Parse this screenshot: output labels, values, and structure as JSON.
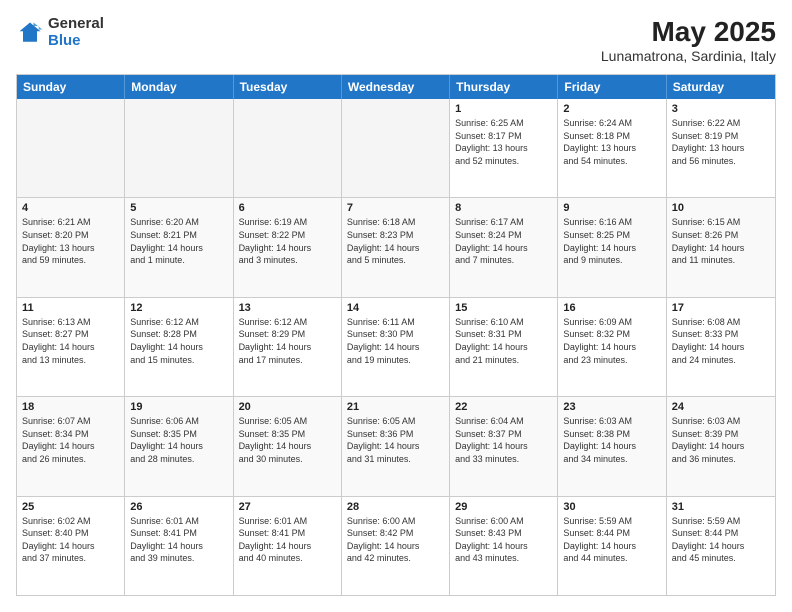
{
  "logo": {
    "general": "General",
    "blue": "Blue"
  },
  "header": {
    "month_year": "May 2025",
    "location": "Lunamatrona, Sardinia, Italy"
  },
  "days_of_week": [
    "Sunday",
    "Monday",
    "Tuesday",
    "Wednesday",
    "Thursday",
    "Friday",
    "Saturday"
  ],
  "weeks": [
    [
      {
        "day": "",
        "data": "",
        "empty": true
      },
      {
        "day": "",
        "data": "",
        "empty": true
      },
      {
        "day": "",
        "data": "",
        "empty": true
      },
      {
        "day": "",
        "data": "",
        "empty": true
      },
      {
        "day": "1",
        "data": "Sunrise: 6:25 AM\nSunset: 8:17 PM\nDaylight: 13 hours\nand 52 minutes.",
        "empty": false
      },
      {
        "day": "2",
        "data": "Sunrise: 6:24 AM\nSunset: 8:18 PM\nDaylight: 13 hours\nand 54 minutes.",
        "empty": false
      },
      {
        "day": "3",
        "data": "Sunrise: 6:22 AM\nSunset: 8:19 PM\nDaylight: 13 hours\nand 56 minutes.",
        "empty": false
      }
    ],
    [
      {
        "day": "4",
        "data": "Sunrise: 6:21 AM\nSunset: 8:20 PM\nDaylight: 13 hours\nand 59 minutes.",
        "empty": false
      },
      {
        "day": "5",
        "data": "Sunrise: 6:20 AM\nSunset: 8:21 PM\nDaylight: 14 hours\nand 1 minute.",
        "empty": false
      },
      {
        "day": "6",
        "data": "Sunrise: 6:19 AM\nSunset: 8:22 PM\nDaylight: 14 hours\nand 3 minutes.",
        "empty": false
      },
      {
        "day": "7",
        "data": "Sunrise: 6:18 AM\nSunset: 8:23 PM\nDaylight: 14 hours\nand 5 minutes.",
        "empty": false
      },
      {
        "day": "8",
        "data": "Sunrise: 6:17 AM\nSunset: 8:24 PM\nDaylight: 14 hours\nand 7 minutes.",
        "empty": false
      },
      {
        "day": "9",
        "data": "Sunrise: 6:16 AM\nSunset: 8:25 PM\nDaylight: 14 hours\nand 9 minutes.",
        "empty": false
      },
      {
        "day": "10",
        "data": "Sunrise: 6:15 AM\nSunset: 8:26 PM\nDaylight: 14 hours\nand 11 minutes.",
        "empty": false
      }
    ],
    [
      {
        "day": "11",
        "data": "Sunrise: 6:13 AM\nSunset: 8:27 PM\nDaylight: 14 hours\nand 13 minutes.",
        "empty": false
      },
      {
        "day": "12",
        "data": "Sunrise: 6:12 AM\nSunset: 8:28 PM\nDaylight: 14 hours\nand 15 minutes.",
        "empty": false
      },
      {
        "day": "13",
        "data": "Sunrise: 6:12 AM\nSunset: 8:29 PM\nDaylight: 14 hours\nand 17 minutes.",
        "empty": false
      },
      {
        "day": "14",
        "data": "Sunrise: 6:11 AM\nSunset: 8:30 PM\nDaylight: 14 hours\nand 19 minutes.",
        "empty": false
      },
      {
        "day": "15",
        "data": "Sunrise: 6:10 AM\nSunset: 8:31 PM\nDaylight: 14 hours\nand 21 minutes.",
        "empty": false
      },
      {
        "day": "16",
        "data": "Sunrise: 6:09 AM\nSunset: 8:32 PM\nDaylight: 14 hours\nand 23 minutes.",
        "empty": false
      },
      {
        "day": "17",
        "data": "Sunrise: 6:08 AM\nSunset: 8:33 PM\nDaylight: 14 hours\nand 24 minutes.",
        "empty": false
      }
    ],
    [
      {
        "day": "18",
        "data": "Sunrise: 6:07 AM\nSunset: 8:34 PM\nDaylight: 14 hours\nand 26 minutes.",
        "empty": false
      },
      {
        "day": "19",
        "data": "Sunrise: 6:06 AM\nSunset: 8:35 PM\nDaylight: 14 hours\nand 28 minutes.",
        "empty": false
      },
      {
        "day": "20",
        "data": "Sunrise: 6:05 AM\nSunset: 8:35 PM\nDaylight: 14 hours\nand 30 minutes.",
        "empty": false
      },
      {
        "day": "21",
        "data": "Sunrise: 6:05 AM\nSunset: 8:36 PM\nDaylight: 14 hours\nand 31 minutes.",
        "empty": false
      },
      {
        "day": "22",
        "data": "Sunrise: 6:04 AM\nSunset: 8:37 PM\nDaylight: 14 hours\nand 33 minutes.",
        "empty": false
      },
      {
        "day": "23",
        "data": "Sunrise: 6:03 AM\nSunset: 8:38 PM\nDaylight: 14 hours\nand 34 minutes.",
        "empty": false
      },
      {
        "day": "24",
        "data": "Sunrise: 6:03 AM\nSunset: 8:39 PM\nDaylight: 14 hours\nand 36 minutes.",
        "empty": false
      }
    ],
    [
      {
        "day": "25",
        "data": "Sunrise: 6:02 AM\nSunset: 8:40 PM\nDaylight: 14 hours\nand 37 minutes.",
        "empty": false
      },
      {
        "day": "26",
        "data": "Sunrise: 6:01 AM\nSunset: 8:41 PM\nDaylight: 14 hours\nand 39 minutes.",
        "empty": false
      },
      {
        "day": "27",
        "data": "Sunrise: 6:01 AM\nSunset: 8:41 PM\nDaylight: 14 hours\nand 40 minutes.",
        "empty": false
      },
      {
        "day": "28",
        "data": "Sunrise: 6:00 AM\nSunset: 8:42 PM\nDaylight: 14 hours\nand 42 minutes.",
        "empty": false
      },
      {
        "day": "29",
        "data": "Sunrise: 6:00 AM\nSunset: 8:43 PM\nDaylight: 14 hours\nand 43 minutes.",
        "empty": false
      },
      {
        "day": "30",
        "data": "Sunrise: 5:59 AM\nSunset: 8:44 PM\nDaylight: 14 hours\nand 44 minutes.",
        "empty": false
      },
      {
        "day": "31",
        "data": "Sunrise: 5:59 AM\nSunset: 8:44 PM\nDaylight: 14 hours\nand 45 minutes.",
        "empty": false
      }
    ]
  ]
}
